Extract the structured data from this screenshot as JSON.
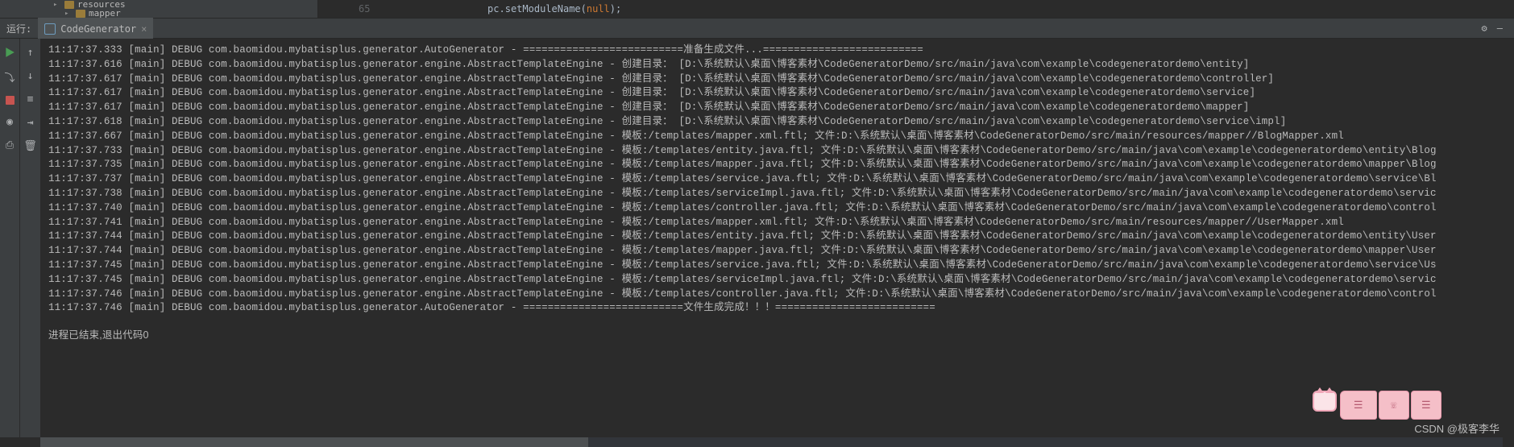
{
  "tree": {
    "resources": "resources",
    "mapper": "mapper"
  },
  "editor": {
    "lineno": "65",
    "code_prefix": "                pc.setModuleName(",
    "code_kw": "null",
    "code_suffix": ");"
  },
  "run": {
    "label": "运行:",
    "tab_name": "CodeGenerator",
    "tab_close": "×",
    "gear": "⚙",
    "minus": "—"
  },
  "console_lines": [
    "11:17:37.333 [main] DEBUG com.baomidou.mybatisplus.generator.AutoGenerator - ==========================准备生成文件...==========================",
    "11:17:37.616 [main] DEBUG com.baomidou.mybatisplus.generator.engine.AbstractTemplateEngine - 创建目录： [D:\\系统默认\\桌面\\博客素材\\CodeGeneratorDemo/src/main/java\\com\\example\\codegeneratordemo\\entity]",
    "11:17:37.617 [main] DEBUG com.baomidou.mybatisplus.generator.engine.AbstractTemplateEngine - 创建目录： [D:\\系统默认\\桌面\\博客素材\\CodeGeneratorDemo/src/main/java\\com\\example\\codegeneratordemo\\controller]",
    "11:17:37.617 [main] DEBUG com.baomidou.mybatisplus.generator.engine.AbstractTemplateEngine - 创建目录： [D:\\系统默认\\桌面\\博客素材\\CodeGeneratorDemo/src/main/java\\com\\example\\codegeneratordemo\\service]",
    "11:17:37.617 [main] DEBUG com.baomidou.mybatisplus.generator.engine.AbstractTemplateEngine - 创建目录： [D:\\系统默认\\桌面\\博客素材\\CodeGeneratorDemo/src/main/java\\com\\example\\codegeneratordemo\\mapper]",
    "11:17:37.618 [main] DEBUG com.baomidou.mybatisplus.generator.engine.AbstractTemplateEngine - 创建目录： [D:\\系统默认\\桌面\\博客素材\\CodeGeneratorDemo/src/main/java\\com\\example\\codegeneratordemo\\service\\impl]",
    "11:17:37.667 [main] DEBUG com.baomidou.mybatisplus.generator.engine.AbstractTemplateEngine - 模板:/templates/mapper.xml.ftl;  文件:D:\\系统默认\\桌面\\博客素材\\CodeGeneratorDemo/src/main/resources/mapper//BlogMapper.xml",
    "11:17:37.733 [main] DEBUG com.baomidou.mybatisplus.generator.engine.AbstractTemplateEngine - 模板:/templates/entity.java.ftl;  文件:D:\\系统默认\\桌面\\博客素材\\CodeGeneratorDemo/src/main/java\\com\\example\\codegeneratordemo\\entity\\Blog",
    "11:17:37.735 [main] DEBUG com.baomidou.mybatisplus.generator.engine.AbstractTemplateEngine - 模板:/templates/mapper.java.ftl;  文件:D:\\系统默认\\桌面\\博客素材\\CodeGeneratorDemo/src/main/java\\com\\example\\codegeneratordemo\\mapper\\Blog",
    "11:17:37.737 [main] DEBUG com.baomidou.mybatisplus.generator.engine.AbstractTemplateEngine - 模板:/templates/service.java.ftl;  文件:D:\\系统默认\\桌面\\博客素材\\CodeGeneratorDemo/src/main/java\\com\\example\\codegeneratordemo\\service\\Bl",
    "11:17:37.738 [main] DEBUG com.baomidou.mybatisplus.generator.engine.AbstractTemplateEngine - 模板:/templates/serviceImpl.java.ftl;  文件:D:\\系统默认\\桌面\\博客素材\\CodeGeneratorDemo/src/main/java\\com\\example\\codegeneratordemo\\servic",
    "11:17:37.740 [main] DEBUG com.baomidou.mybatisplus.generator.engine.AbstractTemplateEngine - 模板:/templates/controller.java.ftl;  文件:D:\\系统默认\\桌面\\博客素材\\CodeGeneratorDemo/src/main/java\\com\\example\\codegeneratordemo\\control",
    "11:17:37.741 [main] DEBUG com.baomidou.mybatisplus.generator.engine.AbstractTemplateEngine - 模板:/templates/mapper.xml.ftl;  文件:D:\\系统默认\\桌面\\博客素材\\CodeGeneratorDemo/src/main/resources/mapper//UserMapper.xml",
    "11:17:37.744 [main] DEBUG com.baomidou.mybatisplus.generator.engine.AbstractTemplateEngine - 模板:/templates/entity.java.ftl;  文件:D:\\系统默认\\桌面\\博客素材\\CodeGeneratorDemo/src/main/java\\com\\example\\codegeneratordemo\\entity\\User",
    "11:17:37.744 [main] DEBUG com.baomidou.mybatisplus.generator.engine.AbstractTemplateEngine - 模板:/templates/mapper.java.ftl;  文件:D:\\系统默认\\桌面\\博客素材\\CodeGeneratorDemo/src/main/java\\com\\example\\codegeneratordemo\\mapper\\User",
    "11:17:37.745 [main] DEBUG com.baomidou.mybatisplus.generator.engine.AbstractTemplateEngine - 模板:/templates/service.java.ftl;  文件:D:\\系统默认\\桌面\\博客素材\\CodeGeneratorDemo/src/main/java\\com\\example\\codegeneratordemo\\service\\Us",
    "11:17:37.745 [main] DEBUG com.baomidou.mybatisplus.generator.engine.AbstractTemplateEngine - 模板:/templates/serviceImpl.java.ftl;  文件:D:\\系统默认\\桌面\\博客素材\\CodeGeneratorDemo/src/main/java\\com\\example\\codegeneratordemo\\servic",
    "11:17:37.746 [main] DEBUG com.baomidou.mybatisplus.generator.engine.AbstractTemplateEngine - 模板:/templates/controller.java.ftl;  文件:D:\\系统默认\\桌面\\博客素材\\CodeGeneratorDemo/src/main/java\\com\\example\\codegeneratordemo\\control",
    "11:17:37.746 [main] DEBUG com.baomidou.mybatisplus.generator.AutoGenerator - ==========================文件生成完成！！！=========================="
  ],
  "exit_text": "进程已结束,退出代码0",
  "watermark": "CSDN @极客李华",
  "overlay_icons": {
    "a": "☰",
    "b": "☏",
    "c": "☰"
  }
}
